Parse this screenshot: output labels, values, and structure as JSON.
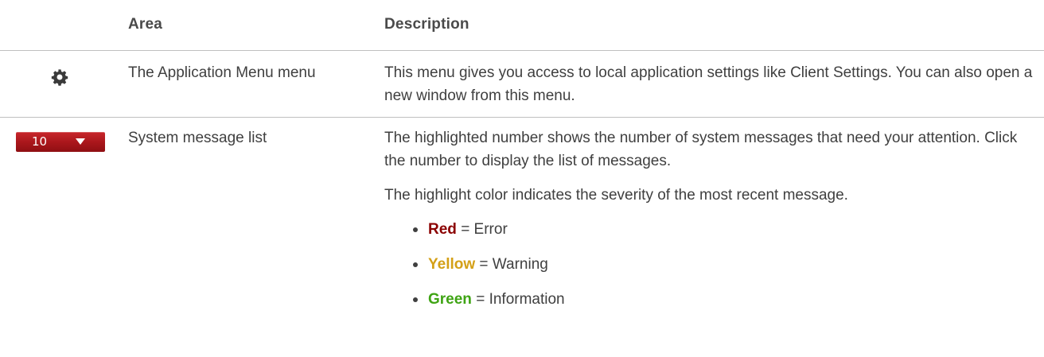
{
  "table": {
    "headers": {
      "area": "Area",
      "description": "Description"
    },
    "rows": [
      {
        "icon": "gear-icon",
        "area": "The Application Menu menu",
        "description": "This menu gives you access to local application settings like Client Settings. You can also open a new window from this menu."
      },
      {
        "icon": "system-message-badge",
        "badge_count": "10",
        "area": "System message list",
        "description_1": "The highlighted number shows the number of system messages that need your attention. Click the number to display the list of messages.",
        "description_2": "The highlight color indicates the severity of the most recent message.",
        "severities": [
          {
            "name": "Red",
            "meaning": "= Error",
            "color": "#8b0000"
          },
          {
            "name": "Yellow",
            "meaning": "= Warning",
            "color": "#d4a017"
          },
          {
            "name": "Green",
            "meaning": "= Information",
            "color": "#3fa414"
          }
        ]
      }
    ]
  },
  "colors": {
    "badge": "#b01c21",
    "border": "#bfbfbf",
    "text": "#3f3f3f"
  }
}
